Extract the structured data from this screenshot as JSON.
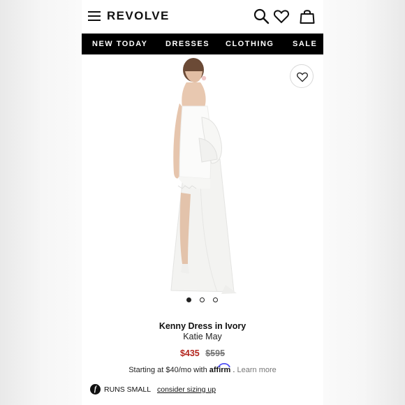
{
  "header": {
    "brand": "REVOLVE",
    "icons": [
      "menu-icon",
      "search-icon",
      "heart-icon",
      "bag-icon"
    ]
  },
  "nav": {
    "items": [
      "NEW TODAY",
      "DRESSES",
      "CLOTHING",
      "SALE"
    ]
  },
  "gallery": {
    "image_count": 3,
    "active_index": 0
  },
  "product": {
    "name": "Kenny Dress in Ivory",
    "designer": "Katie May",
    "sale_price": "$435",
    "original_price": "$595",
    "financing_text": "Starting at $40/mo with",
    "financing_brand": "affirm",
    "learn_more": "Learn more",
    "fit_note": "RUNS SMALL",
    "sizing_link": "consider sizing up"
  },
  "colors": {
    "sale_price": "#b3261e",
    "nav_background": "#000000"
  }
}
